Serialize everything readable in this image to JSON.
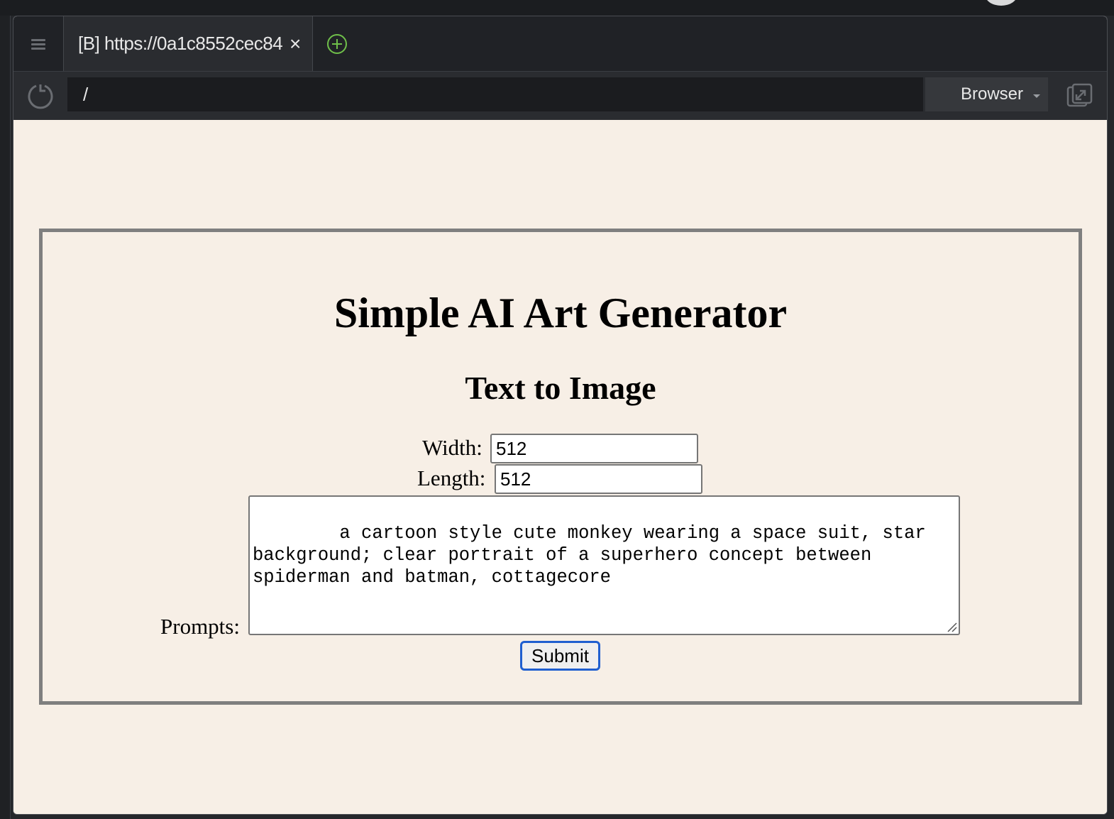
{
  "browser": {
    "tab": {
      "title": "[B] https://0a1c8552cec84",
      "close_glyph": "×"
    },
    "address_bar": {
      "value": "/"
    },
    "mode_selector": {
      "value": "Browser"
    },
    "icons": [
      "menu-icon",
      "close-icon",
      "new-tab-icon",
      "reload-icon",
      "dropdown-caret-icon",
      "popout-icon"
    ]
  },
  "page": {
    "title": "Simple AI Art Generator",
    "subtitle": "Text to Image",
    "form": {
      "width_label": "Width:",
      "width_value": "512",
      "length_label": "Length:",
      "length_value": "512",
      "prompts_label": "Prompts:",
      "prompts_value": "a cartoon style cute monkey wearing a space suit, star background; clear portrait of a superhero concept between spiderman and batman, cottagecore",
      "submit_label": "Submit"
    }
  },
  "colors": {
    "page_background": "#f7efe6",
    "card_border": "#7f7f7f",
    "submit_focus_ring": "#1f5fd0",
    "chrome_dark": "#202226",
    "new_tab_accent": "#6fbf4a"
  }
}
